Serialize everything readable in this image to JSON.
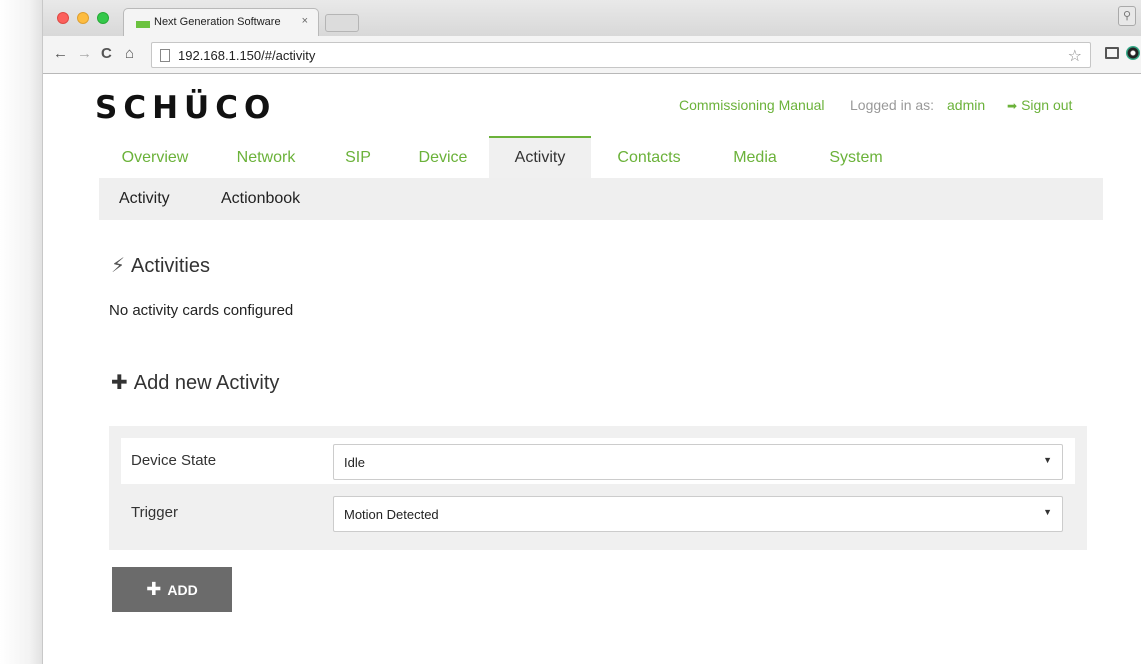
{
  "browser": {
    "tab_title": "Next Generation Software",
    "tab_close": "×",
    "url": "192.168.1.150/#/activity"
  },
  "brand": {
    "logo_text": "SCHÜCO",
    "accent": "#6bb23a"
  },
  "header": {
    "manual_link": "Commissioning Manual",
    "logged_in_label": "Logged in as:",
    "username": "admin",
    "sign_out": "Sign out"
  },
  "main_nav": [
    "Overview",
    "Network",
    "SIP",
    "Device",
    "Activity",
    "Contacts",
    "Media",
    "System"
  ],
  "main_nav_active": "Activity",
  "sub_nav": [
    "Activity",
    "Actionbook"
  ],
  "activities": {
    "title": "Activities",
    "empty_text": "No activity cards configured"
  },
  "add_activity": {
    "title": "Add new Activity",
    "device_state_label": "Device State",
    "device_state_value": "Idle",
    "trigger_label": "Trigger",
    "trigger_value": "Motion Detected",
    "add_button": "ADD"
  }
}
